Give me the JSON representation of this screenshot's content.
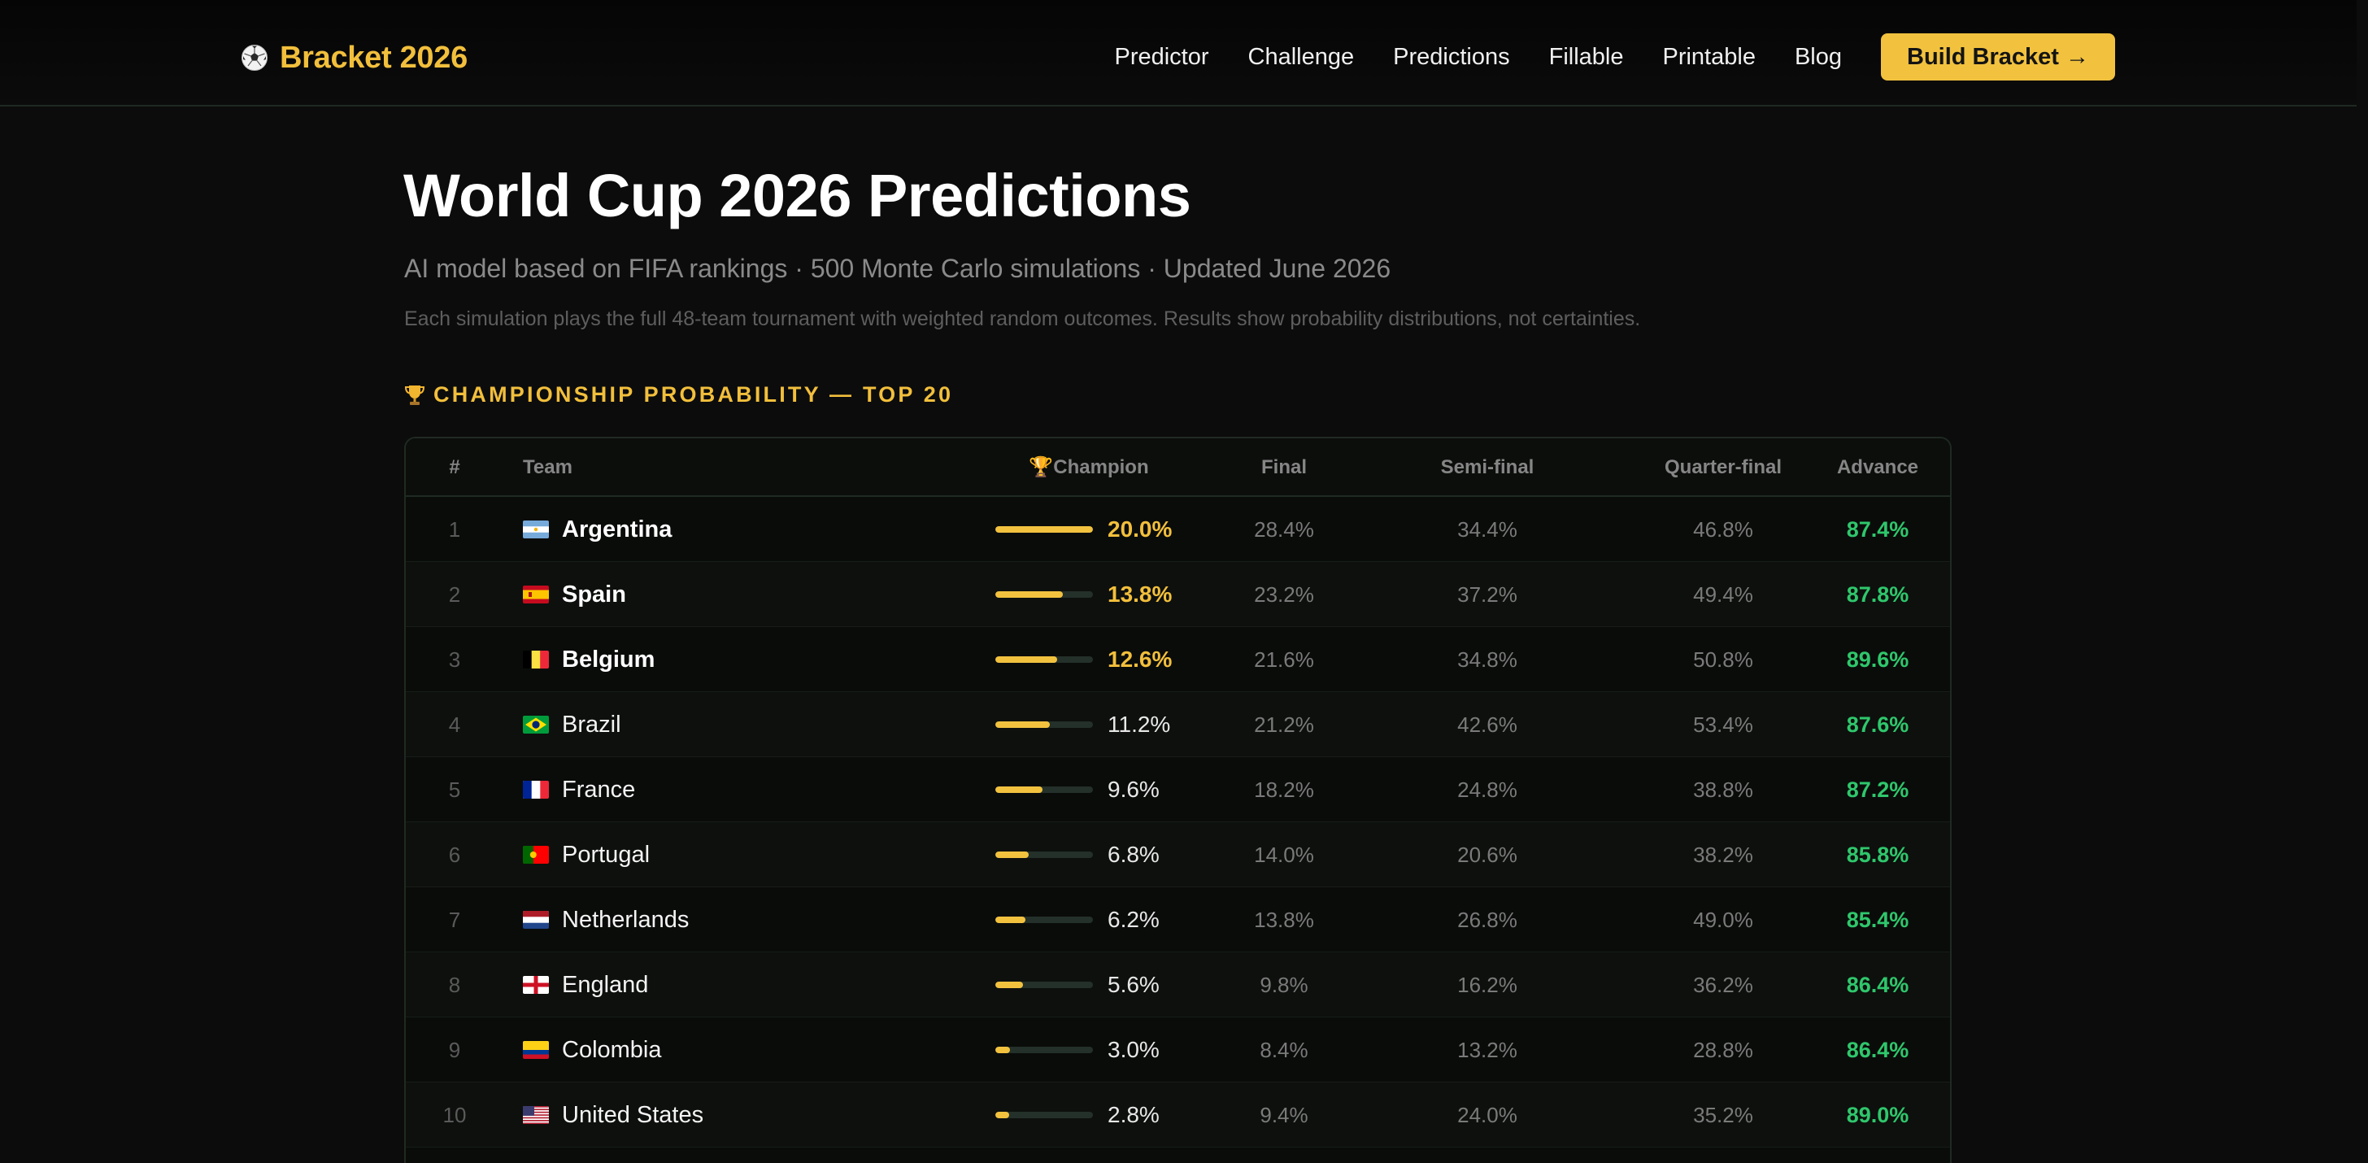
{
  "nav": {
    "brand": "Bracket 2026",
    "brand_icon": "soccer-ball-icon",
    "links": [
      "Predictor",
      "Challenge",
      "Predictions",
      "Fillable",
      "Printable",
      "Blog"
    ],
    "cta_label": "Build Bracket →"
  },
  "page": {
    "title": "World Cup 2026 Predictions",
    "subtitle": "AI model based on FIFA rankings · 500 Monte Carlo simulations · Updated June 2026",
    "note": "Each simulation plays the full 48-team tournament with weighted random outcomes. Results show probability distributions, not certainties.",
    "section_title": "CHAMPIONSHIP PROBABILITY — TOP 20",
    "section_icon": "trophy-icon"
  },
  "table": {
    "headers": {
      "rank": "#",
      "team": "Team",
      "champion": "Champion",
      "final": "Final",
      "semi": "Semi-final",
      "quarter": "Quarter-final",
      "advance": "Advance"
    },
    "rows": [
      {
        "rank": "1",
        "team": "Argentina",
        "flag": "argentina",
        "champion": "20.0%",
        "champion_value": 20.0,
        "final": "28.4%",
        "semi": "34.4%",
        "quarter": "46.8%",
        "advance": "87.4%"
      },
      {
        "rank": "2",
        "team": "Spain",
        "flag": "spain",
        "champion": "13.8%",
        "champion_value": 13.8,
        "final": "23.2%",
        "semi": "37.2%",
        "quarter": "49.4%",
        "advance": "87.8%"
      },
      {
        "rank": "3",
        "team": "Belgium",
        "flag": "belgium",
        "champion": "12.6%",
        "champion_value": 12.6,
        "final": "21.6%",
        "semi": "34.8%",
        "quarter": "50.8%",
        "advance": "89.6%"
      },
      {
        "rank": "4",
        "team": "Brazil",
        "flag": "brazil",
        "champion": "11.2%",
        "champion_value": 11.2,
        "final": "21.2%",
        "semi": "42.6%",
        "quarter": "53.4%",
        "advance": "87.6%"
      },
      {
        "rank": "5",
        "team": "France",
        "flag": "france",
        "champion": "9.6%",
        "champion_value": 9.6,
        "final": "18.2%",
        "semi": "24.8%",
        "quarter": "38.8%",
        "advance": "87.2%"
      },
      {
        "rank": "6",
        "team": "Portugal",
        "flag": "portugal",
        "champion": "6.8%",
        "champion_value": 6.8,
        "final": "14.0%",
        "semi": "20.6%",
        "quarter": "38.2%",
        "advance": "85.8%"
      },
      {
        "rank": "7",
        "team": "Netherlands",
        "flag": "netherlands",
        "champion": "6.2%",
        "champion_value": 6.2,
        "final": "13.8%",
        "semi": "26.8%",
        "quarter": "49.0%",
        "advance": "85.4%"
      },
      {
        "rank": "8",
        "team": "England",
        "flag": "england",
        "champion": "5.6%",
        "champion_value": 5.6,
        "final": "9.8%",
        "semi": "16.2%",
        "quarter": "36.2%",
        "advance": "86.4%"
      },
      {
        "rank": "9",
        "team": "Colombia",
        "flag": "colombia",
        "champion": "3.0%",
        "champion_value": 3.0,
        "final": "8.4%",
        "semi": "13.2%",
        "quarter": "28.8%",
        "advance": "86.4%"
      },
      {
        "rank": "10",
        "team": "United States",
        "flag": "united-states",
        "champion": "2.8%",
        "champion_value": 2.8,
        "final": "9.4%",
        "semi": "24.0%",
        "quarter": "35.2%",
        "advance": "89.0%"
      }
    ]
  },
  "colors": {
    "accent": "#f2c23f",
    "advance_green": "#2fc76c",
    "background": "#0c0c0c"
  }
}
